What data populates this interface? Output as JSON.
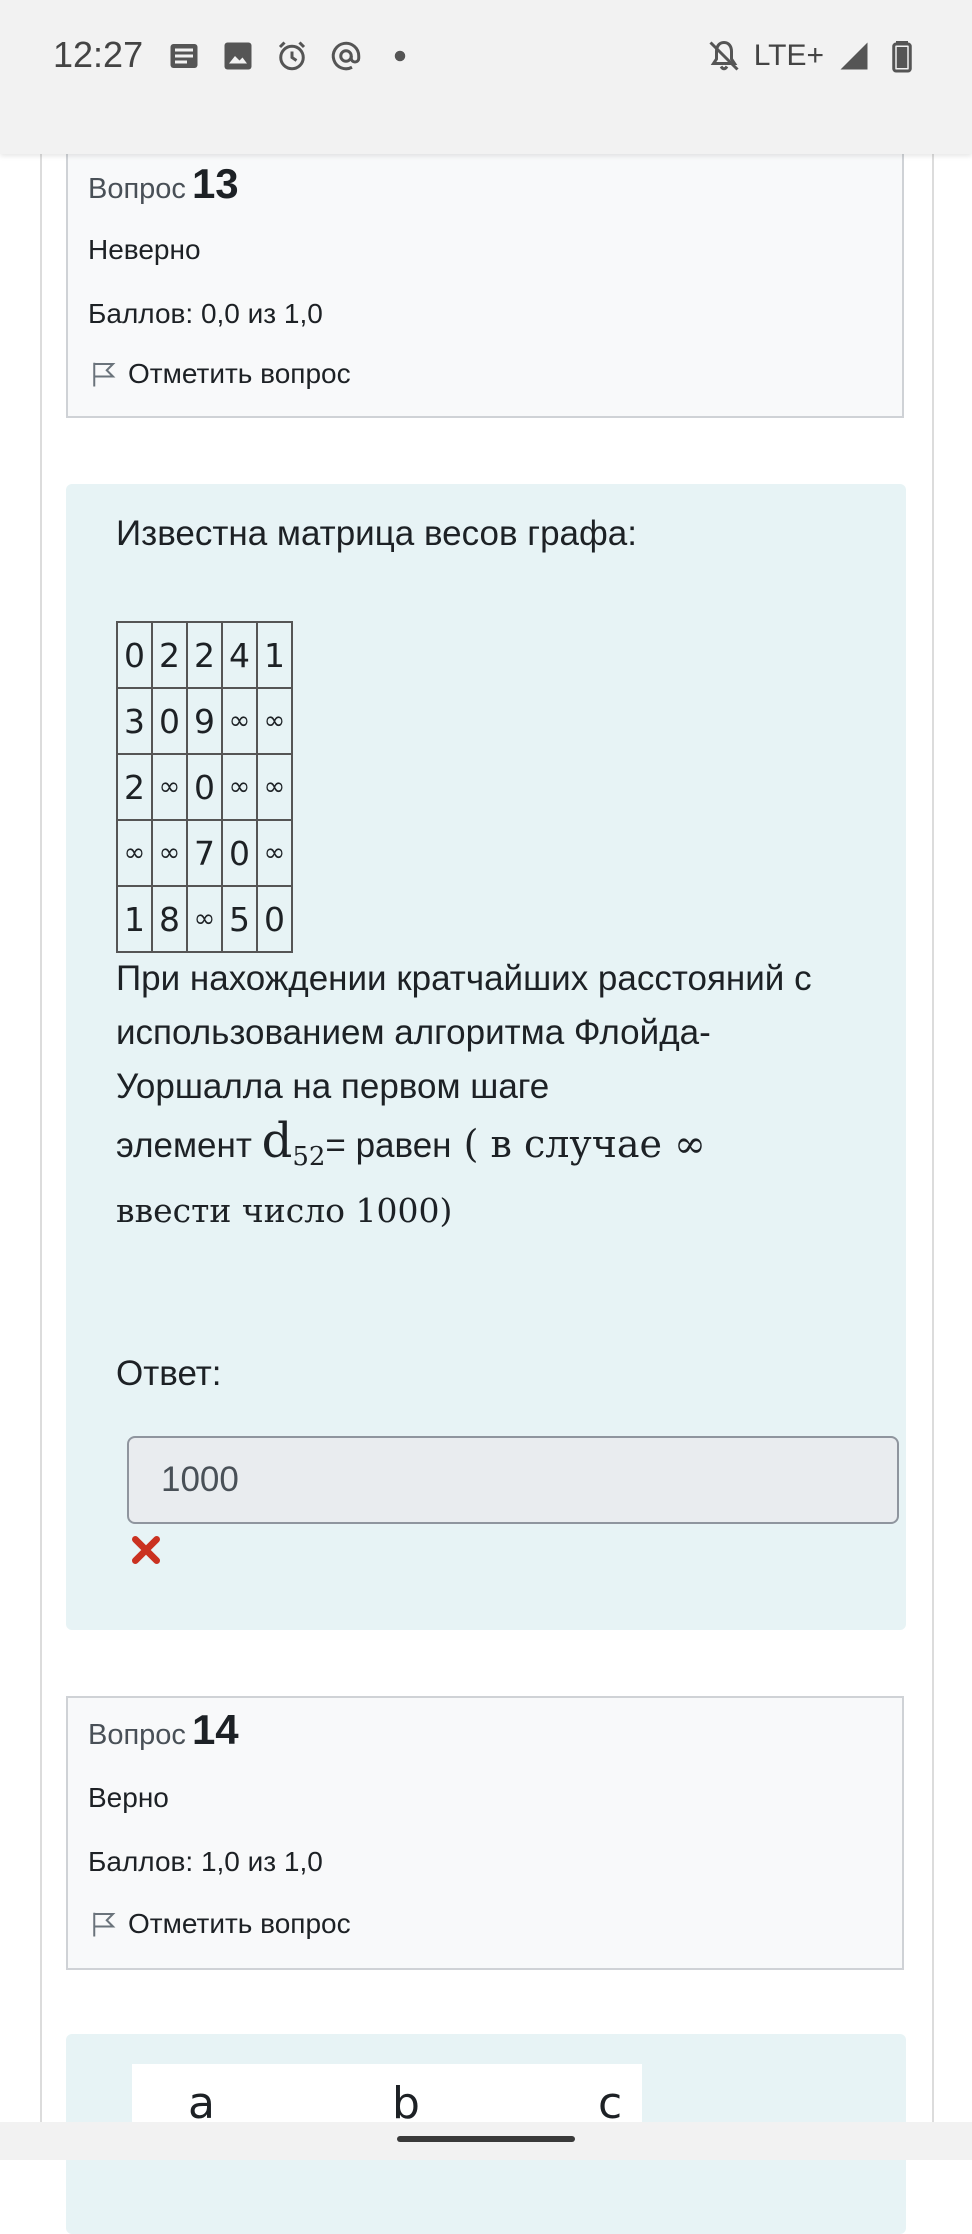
{
  "status_bar": {
    "time": "12:27",
    "left_icons": [
      "news-icon",
      "image-icon",
      "alarm-icon",
      "at-icon",
      "dot-icon"
    ],
    "network": "LTE+",
    "right_icons": [
      "bell-off-icon",
      "signal-icon",
      "battery-icon"
    ]
  },
  "question_13": {
    "prefix": "Вопрос",
    "number": "13",
    "state": "Неверно",
    "grade": "Баллов: 0,0 из 1,0",
    "flag_label": "Отметить вопрос"
  },
  "question_13_content": {
    "intro": "Известна матрица весов графа:",
    "matrix": [
      [
        "0",
        "2",
        "2",
        "4",
        "1"
      ],
      [
        "3",
        "0",
        "9",
        "∞",
        "∞"
      ],
      [
        "2",
        "∞",
        "0",
        "∞",
        "∞"
      ],
      [
        "∞",
        "∞",
        "7",
        "0",
        "∞"
      ],
      [
        "1",
        "8",
        "∞",
        "5",
        "0"
      ]
    ],
    "body_line1": "При нахождении кратчайших расстояний с использованием алгоритма Флойда-Уоршалла на первом шаге",
    "element_prefix": "элемент ",
    "element_symbol": "d",
    "element_subscript": "52",
    "element_suffix": "= равен",
    "serif_part1": " ( в случае ∞",
    "serif_part2": "ввести число 1000)",
    "answer_label": "Ответ:",
    "answer_value": "1000",
    "answer_status_icon": "incorrect-cross-icon",
    "accent_wrong": "#ca3120"
  },
  "question_14": {
    "prefix": "Вопрос",
    "number": "14",
    "state": "Верно",
    "grade": "Баллов: 1,0 из 1,0",
    "flag_label": "Отметить вопрос"
  },
  "question_14_content": {
    "labels": [
      "a",
      "b",
      "c"
    ]
  },
  "colors": {
    "content_bg": "#e7f3f5",
    "info_bg": "#f8f9fa",
    "info_border": "#cfd2d6"
  }
}
